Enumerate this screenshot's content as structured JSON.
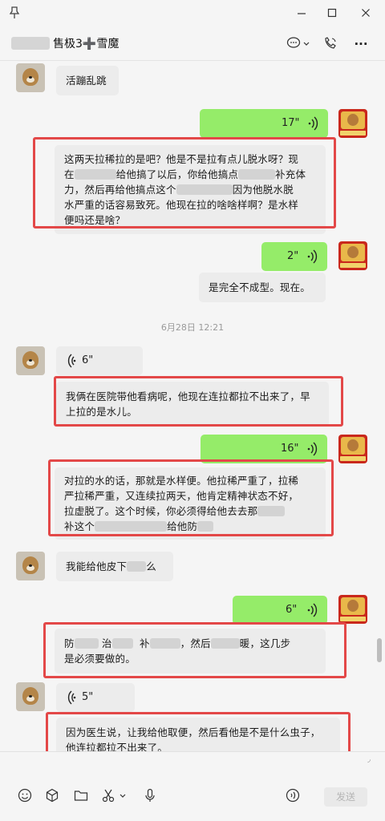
{
  "window": {
    "pin_icon": "pin-icon",
    "minimize_icon": "minimize-icon",
    "maximize_icon": "maximize-icon",
    "close_icon": "close-icon"
  },
  "header": {
    "title": "售极3➕雪魔",
    "more_label": "···"
  },
  "messages": {
    "m1_text": "活蹦乱跳",
    "m2_duration": "17\"",
    "m3_lines": [
      "这两天拉稀拉的是吧？他是不是拉有点儿脱水呀？现",
      "在",
      "给他搞了以后，你给他搞点",
      "补充体",
      "力，然后再给他搞点这个",
      "因为他脱水脱",
      "水严重的话容易致死。他现在拉的啥啥样啊？是水样",
      "便吗还是啥？"
    ],
    "m4_duration": "2\"",
    "m5_text": "是完全不成型。现在。",
    "timestamp": "6月28日 12:21",
    "m6_duration": "6\"",
    "m7_text": "我俩在医院带他看病呢，他现在连拉都拉不出来了，早上拉的是水儿。",
    "m8_duration": "16\"",
    "m9_lines": [
      "对拉的水的话，那就是水样便。他拉稀严重了，拉稀",
      "严拉稀严重，又连续拉两天，他肯定精神状态不好，",
      "拉虚脱了。这个时候，你必须得给他去去那",
      "补这个",
      "给他防"
    ],
    "m10_parts": [
      "我能给他皮下",
      "么"
    ],
    "m11_duration": "6\"",
    "m12_parts": [
      "防",
      "治",
      "补",
      "，然后",
      "暖，这几步",
      "是必须要做的。"
    ],
    "m13_duration": "5\"",
    "m14_text": "因为医生说，让我给他取便，然后看他是不是什么虫子，他连拉都拉不出来了。"
  },
  "input": {
    "send_label": "发送"
  },
  "colors": {
    "accent_green": "#95ec69",
    "highlight_red": "#e34848",
    "bubble_gray": "#ececec"
  }
}
